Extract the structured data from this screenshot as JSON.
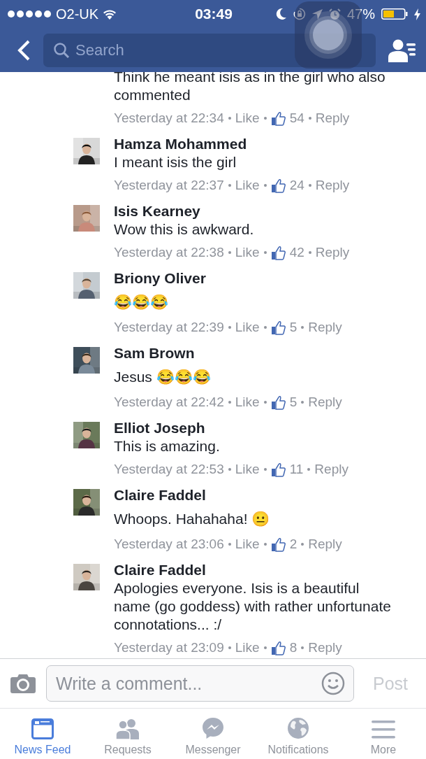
{
  "status_bar": {
    "carrier": "O2-UK",
    "time": "03:49",
    "battery": "47%"
  },
  "header": {
    "search": {
      "placeholder": "Search"
    }
  },
  "comments": [
    {
      "body": "Think he meant isis as in the girl who also commented",
      "time": "Yesterday at 22:34",
      "like": "Like",
      "likes": "54",
      "reply": "Reply"
    },
    {
      "name": "Hamza Mohammed",
      "body": "I meant isis the girl",
      "time": "Yesterday at 22:37",
      "like": "Like",
      "likes": "24",
      "reply": "Reply"
    },
    {
      "name": "Isis Kearney",
      "body": "Wow this is awkward.",
      "time": "Yesterday at 22:38",
      "like": "Like",
      "likes": "42",
      "reply": "Reply"
    },
    {
      "name": "Briony Oliver",
      "kind": "emoji",
      "body": "😂😂😂",
      "time": "Yesterday at 22:39",
      "like": "Like",
      "likes": "5",
      "reply": "Reply"
    },
    {
      "name": "Sam Brown",
      "kind": "emoji",
      "body": "Jesus 😂😂😂",
      "time": "Yesterday at 22:42",
      "like": "Like",
      "likes": "5",
      "reply": "Reply"
    },
    {
      "name": "Elliot Joseph",
      "body": "This is amazing.",
      "time": "Yesterday at 22:53",
      "like": "Like",
      "likes": "11",
      "reply": "Reply"
    },
    {
      "name": "Claire Faddel",
      "kind": "emoji",
      "body": "Whoops. Hahahaha! 😐",
      "time": "Yesterday at 23:06",
      "like": "Like",
      "likes": "2",
      "reply": "Reply"
    },
    {
      "name": "Claire Faddel",
      "body": "Apologies everyone. Isis is a beautiful name (go goddess) with rather unfortunate connotations... :/",
      "time": "Yesterday at 23:09",
      "like": "Like",
      "likes": "8",
      "reply": "Reply"
    }
  ],
  "composer": {
    "placeholder": "Write a comment...",
    "post": {
      "label": "Post",
      "disabled": true
    }
  },
  "tabs": [
    {
      "kind": "feed",
      "label": "News Feed",
      "selected": true
    },
    {
      "kind": "requests",
      "label": "Requests",
      "selected": false
    },
    {
      "kind": "messenger",
      "label": "Messenger",
      "selected": false
    },
    {
      "kind": "notifications",
      "label": "Notifications",
      "selected": false
    },
    {
      "kind": "more",
      "label": "More",
      "selected": false
    }
  ]
}
